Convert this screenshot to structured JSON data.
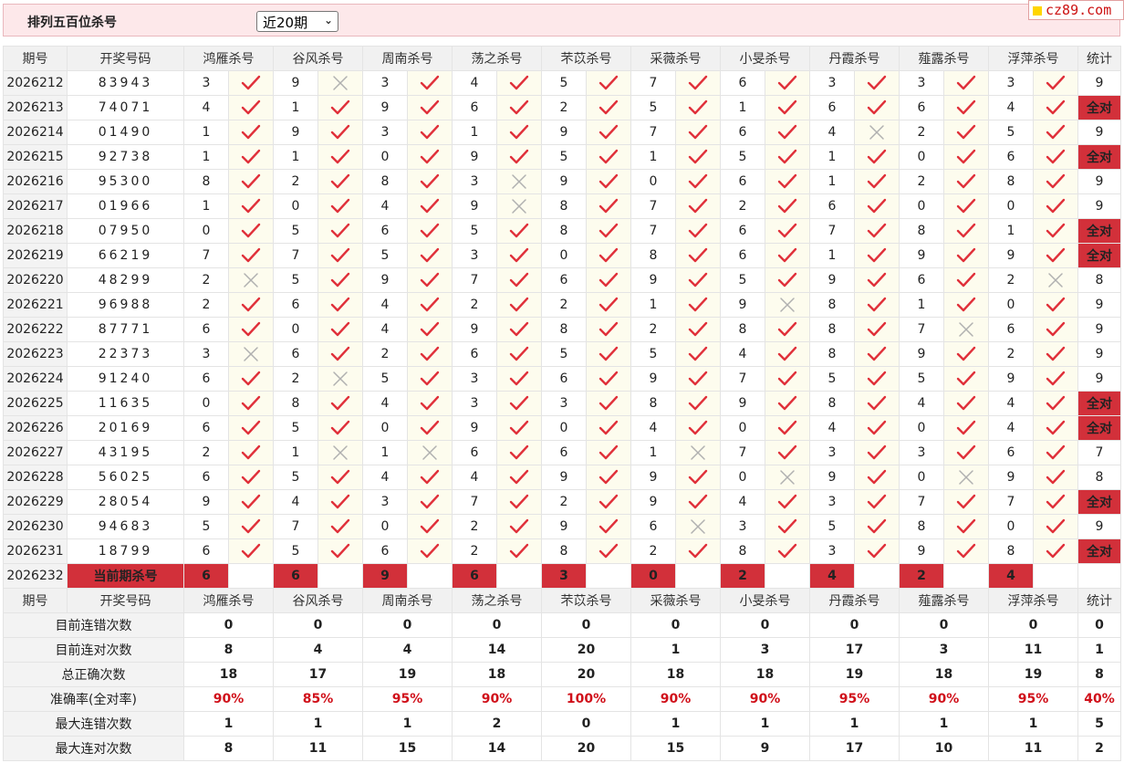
{
  "header": {
    "title": "排列五百位杀号",
    "select_value": "近20期",
    "logo_text": "cz89.com"
  },
  "columns": {
    "period": "期号",
    "number": "开奖号码",
    "stat": "统计",
    "experts": [
      "鸿雁杀号",
      "谷风杀号",
      "周南杀号",
      "荡之杀号",
      "芣苡杀号",
      "采薇杀号",
      "小旻杀号",
      "丹霞杀号",
      "薤露杀号",
      "浮萍杀号"
    ]
  },
  "rows": [
    {
      "period": "2026212",
      "number": "83943",
      "kills": [
        "3",
        "9",
        "3",
        "4",
        "5",
        "7",
        "6",
        "3",
        "3",
        "3"
      ],
      "hits": [
        1,
        0,
        1,
        1,
        1,
        1,
        1,
        1,
        1,
        1
      ],
      "stat": "9"
    },
    {
      "period": "2026213",
      "number": "74071",
      "kills": [
        "4",
        "1",
        "9",
        "6",
        "2",
        "5",
        "1",
        "6",
        "6",
        "4"
      ],
      "hits": [
        1,
        1,
        1,
        1,
        1,
        1,
        1,
        1,
        1,
        1
      ],
      "stat": "全对"
    },
    {
      "period": "2026214",
      "number": "01490",
      "kills": [
        "1",
        "9",
        "3",
        "1",
        "9",
        "7",
        "6",
        "4",
        "2",
        "5"
      ],
      "hits": [
        1,
        1,
        1,
        1,
        1,
        1,
        1,
        0,
        1,
        1
      ],
      "stat": "9"
    },
    {
      "period": "2026215",
      "number": "92738",
      "kills": [
        "1",
        "1",
        "0",
        "9",
        "5",
        "1",
        "5",
        "1",
        "0",
        "6"
      ],
      "hits": [
        1,
        1,
        1,
        1,
        1,
        1,
        1,
        1,
        1,
        1
      ],
      "stat": "全对"
    },
    {
      "period": "2026216",
      "number": "95300",
      "kills": [
        "8",
        "2",
        "8",
        "3",
        "9",
        "0",
        "6",
        "1",
        "2",
        "8"
      ],
      "hits": [
        1,
        1,
        1,
        0,
        1,
        1,
        1,
        1,
        1,
        1
      ],
      "stat": "9"
    },
    {
      "period": "2026217",
      "number": "01966",
      "kills": [
        "1",
        "0",
        "4",
        "9",
        "8",
        "7",
        "2",
        "6",
        "0",
        "0"
      ],
      "hits": [
        1,
        1,
        1,
        0,
        1,
        1,
        1,
        1,
        1,
        1
      ],
      "stat": "9"
    },
    {
      "period": "2026218",
      "number": "07950",
      "kills": [
        "0",
        "5",
        "6",
        "5",
        "8",
        "7",
        "6",
        "7",
        "8",
        "1"
      ],
      "hits": [
        1,
        1,
        1,
        1,
        1,
        1,
        1,
        1,
        1,
        1
      ],
      "stat": "全对"
    },
    {
      "period": "2026219",
      "number": "66219",
      "kills": [
        "7",
        "7",
        "5",
        "3",
        "0",
        "8",
        "6",
        "1",
        "9",
        "9"
      ],
      "hits": [
        1,
        1,
        1,
        1,
        1,
        1,
        1,
        1,
        1,
        1
      ],
      "stat": "全对"
    },
    {
      "period": "2026220",
      "number": "48299",
      "kills": [
        "2",
        "5",
        "9",
        "7",
        "6",
        "9",
        "5",
        "9",
        "6",
        "2"
      ],
      "hits": [
        0,
        1,
        1,
        1,
        1,
        1,
        1,
        1,
        1,
        0
      ],
      "stat": "8"
    },
    {
      "period": "2026221",
      "number": "96988",
      "kills": [
        "2",
        "6",
        "4",
        "2",
        "2",
        "1",
        "9",
        "8",
        "1",
        "0"
      ],
      "hits": [
        1,
        1,
        1,
        1,
        1,
        1,
        0,
        1,
        1,
        1
      ],
      "stat": "9"
    },
    {
      "period": "2026222",
      "number": "87771",
      "kills": [
        "6",
        "0",
        "4",
        "9",
        "8",
        "2",
        "8",
        "8",
        "7",
        "6"
      ],
      "hits": [
        1,
        1,
        1,
        1,
        1,
        1,
        1,
        1,
        0,
        1
      ],
      "stat": "9"
    },
    {
      "period": "2026223",
      "number": "22373",
      "kills": [
        "3",
        "6",
        "2",
        "6",
        "5",
        "5",
        "4",
        "8",
        "9",
        "2"
      ],
      "hits": [
        0,
        1,
        1,
        1,
        1,
        1,
        1,
        1,
        1,
        1
      ],
      "stat": "9"
    },
    {
      "period": "2026224",
      "number": "91240",
      "kills": [
        "6",
        "2",
        "5",
        "3",
        "6",
        "9",
        "7",
        "5",
        "5",
        "9"
      ],
      "hits": [
        1,
        0,
        1,
        1,
        1,
        1,
        1,
        1,
        1,
        1
      ],
      "stat": "9"
    },
    {
      "period": "2026225",
      "number": "11635",
      "kills": [
        "0",
        "8",
        "4",
        "3",
        "3",
        "8",
        "9",
        "8",
        "4",
        "4"
      ],
      "hits": [
        1,
        1,
        1,
        1,
        1,
        1,
        1,
        1,
        1,
        1
      ],
      "stat": "全对"
    },
    {
      "period": "2026226",
      "number": "20169",
      "kills": [
        "6",
        "5",
        "0",
        "9",
        "0",
        "4",
        "0",
        "4",
        "0",
        "4"
      ],
      "hits": [
        1,
        1,
        1,
        1,
        1,
        1,
        1,
        1,
        1,
        1
      ],
      "stat": "全对"
    },
    {
      "period": "2026227",
      "number": "43195",
      "kills": [
        "2",
        "1",
        "1",
        "6",
        "6",
        "1",
        "7",
        "3",
        "3",
        "6"
      ],
      "hits": [
        1,
        0,
        0,
        1,
        1,
        0,
        1,
        1,
        1,
        1
      ],
      "stat": "7"
    },
    {
      "period": "2026228",
      "number": "56025",
      "kills": [
        "6",
        "5",
        "4",
        "4",
        "9",
        "9",
        "0",
        "9",
        "0",
        "9"
      ],
      "hits": [
        1,
        1,
        1,
        1,
        1,
        1,
        0,
        1,
        0,
        1
      ],
      "stat": "8"
    },
    {
      "period": "2026229",
      "number": "28054",
      "kills": [
        "9",
        "4",
        "3",
        "7",
        "2",
        "9",
        "4",
        "3",
        "7",
        "7"
      ],
      "hits": [
        1,
        1,
        1,
        1,
        1,
        1,
        1,
        1,
        1,
        1
      ],
      "stat": "全对"
    },
    {
      "period": "2026230",
      "number": "94683",
      "kills": [
        "5",
        "7",
        "0",
        "2",
        "9",
        "6",
        "3",
        "5",
        "8",
        "0"
      ],
      "hits": [
        1,
        1,
        1,
        1,
        1,
        0,
        1,
        1,
        1,
        1
      ],
      "stat": "9"
    },
    {
      "period": "2026231",
      "number": "18799",
      "kills": [
        "6",
        "5",
        "6",
        "2",
        "8",
        "2",
        "8",
        "3",
        "9",
        "8"
      ],
      "hits": [
        1,
        1,
        1,
        1,
        1,
        1,
        1,
        1,
        1,
        1
      ],
      "stat": "全对"
    }
  ],
  "current": {
    "period": "2026232",
    "label": "当前期杀号",
    "kills": [
      "6",
      "6",
      "9",
      "6",
      "3",
      "0",
      "2",
      "4",
      "2",
      "4"
    ]
  },
  "stats": [
    {
      "label": "目前连错次数",
      "values": [
        "0",
        "0",
        "0",
        "0",
        "0",
        "0",
        "0",
        "0",
        "0",
        "0"
      ],
      "total": "0",
      "red": false
    },
    {
      "label": "目前连对次数",
      "values": [
        "8",
        "4",
        "4",
        "14",
        "20",
        "1",
        "3",
        "17",
        "3",
        "11"
      ],
      "total": "1",
      "red": false
    },
    {
      "label": "总正确次数",
      "values": [
        "18",
        "17",
        "19",
        "18",
        "20",
        "18",
        "18",
        "19",
        "18",
        "19"
      ],
      "total": "8",
      "red": false
    },
    {
      "label": "准确率(全对率)",
      "values": [
        "90%",
        "85%",
        "95%",
        "90%",
        "100%",
        "90%",
        "90%",
        "95%",
        "90%",
        "95%"
      ],
      "total": "40%",
      "red": true
    },
    {
      "label": "最大连错次数",
      "values": [
        "1",
        "1",
        "1",
        "2",
        "0",
        "1",
        "1",
        "1",
        "1",
        "1"
      ],
      "total": "5",
      "red": false
    },
    {
      "label": "最大连对次数",
      "values": [
        "8",
        "11",
        "15",
        "14",
        "20",
        "15",
        "9",
        "17",
        "10",
        "11"
      ],
      "total": "2",
      "red": false
    }
  ],
  "colors": {
    "accent": "#d2303a",
    "check": "#e0303a",
    "cross": "#b0b0b0",
    "number": "#d0202a",
    "stat_blue": "#1414c8"
  },
  "icons": {
    "hit": "check-icon",
    "miss": "cross-icon"
  }
}
